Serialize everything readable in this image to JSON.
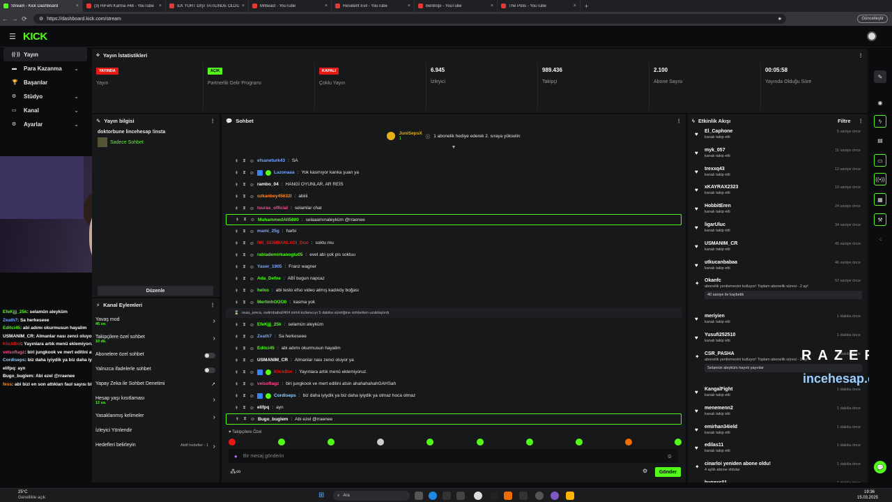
{
  "browser": {
    "tabs": [
      {
        "title": "Stream - Kick Dashboard",
        "active": true,
        "icon": "kick-icon"
      },
      {
        "title": "(3) RiFeN Karma #48 - YouTube",
        "icon": "youtube-icon"
      },
      {
        "title": "İLK YURT DIŞI TATİLİNDE ÖLDÜR...",
        "icon": "youtube-icon"
      },
      {
        "title": "MrBeast - YouTube",
        "icon": "youtube-icon"
      },
      {
        "title": "Resident Evil - YouTube",
        "icon": "youtube-icon"
      },
      {
        "title": "Bentropı - YouTube",
        "icon": "youtube-icon"
      },
      {
        "title": "The Polis - YouTube",
        "icon": "youtube-icon"
      }
    ],
    "url": "https://dashboard.kick.com/stream",
    "update_label": "Güncelleştir"
  },
  "app": {
    "logo": "KICK"
  },
  "nav": [
    {
      "label": "Yayın",
      "icon": "stream-icon",
      "selected": true
    },
    {
      "label": "Para Kazanma",
      "icon": "money-icon",
      "chevron": true
    },
    {
      "label": "Başarılar",
      "icon": "trophy-icon"
    },
    {
      "label": "Stüdyo",
      "icon": "studio-icon",
      "chevron": true
    },
    {
      "label": "Kanal",
      "icon": "channel-icon",
      "chevron": true
    },
    {
      "label": "Ayarlar",
      "icon": "settings-icon",
      "chevron": true
    }
  ],
  "stats": {
    "title": "Yayın İstatistikleri",
    "cells": [
      {
        "badge": "YAYINDA",
        "badge_color": "#e91916",
        "label": "Yayın"
      },
      {
        "badge": "AÇIK",
        "badge_color": "#53fc18",
        "label": "Partnerlik Gelir Programı"
      },
      {
        "badge": "KAPALI",
        "badge_color": "#e91916",
        "label": "Çoklu Yayın"
      },
      {
        "value": "6.945",
        "label": "İzleyici"
      },
      {
        "value": "989.436",
        "label": "Takipçi"
      },
      {
        "value": "2.100",
        "label": "Abone Sayısı"
      },
      {
        "value": "00:05:58",
        "label": "Yayında Olduğu Süre"
      }
    ]
  },
  "info": {
    "title": "Yayın bilgisi",
    "stream_title": "doktorbune lincehesap !insta",
    "mode": "Sadece Sohbet",
    "tag": "Türkçe",
    "edit_label": "Düzenle"
  },
  "overlay_chat": [
    {
      "user": "EfeKjjj_25k",
      "text": "selamün aleyküm",
      "color": "#53fc18"
    },
    {
      "user": "Zeath7",
      "text": "Sa herkeseee",
      "color": "#7aa7ff"
    },
    {
      "user": "Editci45",
      "text": "abi adımı okurmusun hayalim",
      "color": "#53fc18"
    },
    {
      "user": "USMANIM_CR",
      "text": "Almanlar nası zenci oluyor ya",
      "color": "#ffffff"
    },
    {
      "user": "KlickBot",
      "text": "Yayınlara artık menü eklemiyoruz.",
      "color": "#e91916"
    },
    {
      "user": "velsoflagz",
      "text": "biri jungkook ve mert editini atsin ahahahahahGAHSah",
      "color": "#ff4d8d"
    },
    {
      "user": "Cordiseps",
      "text": "biz daha iyiydik ya biz daha iyiydik ya olmaz hoca olmaz",
      "color": "#9ad0ff"
    },
    {
      "user": "elifpq",
      "text": "ayn",
      "color": "#ffffff"
    },
    {
      "user": "Bugo_buglem",
      "text": "Abi ezel @rraenee",
      "color": "#ffffff"
    },
    {
      "user": "fess",
      "text": "abi bizi en son attıkları faul sayısı bitirdi @RRaenee",
      "color": "#ff8c2a"
    }
  ],
  "actions": {
    "title": "Kanal Eylemleri",
    "items": [
      {
        "label": "Yavaş mod",
        "sub": "45 sn.",
        "chevron": true
      },
      {
        "label": "Takipçilere özel sohbet",
        "sub": "10 dk.",
        "chevron": true
      },
      {
        "label": "Abonelere özel sohbet",
        "toggle": true
      },
      {
        "label": "Yalnızca ifadelerle sohbet",
        "toggle": true
      },
      {
        "label": "Yapay Zeka ile Sohbet Denetimi",
        "ext": true
      },
      {
        "label": "Hesap yaşı kısıtlaması",
        "sub": "12 sa.",
        "chevron": true
      },
      {
        "label": "Yasaklanmış kelimeler",
        "chevron": true
      },
      {
        "label": "İzleyici Yönlendir"
      },
      {
        "label": "Hedefleri belirleyin",
        "right": "Aktif hedefler - 1",
        "chevron": true
      }
    ]
  },
  "chat": {
    "title": "Sohbet",
    "gift_user": "JuniSepsX",
    "gift_count": "1",
    "gift_text": "1 abonelik hediye ederek 2. sıraya yükselin",
    "messages": [
      {
        "user": "efsaneturk43",
        "text": "SA",
        "color": "#7aa7ff"
      },
      {
        "user": "Lazonaaa",
        "text": "Yok kasmıyor kanka şuan ya",
        "color": "#7aa7ff",
        "badges": true
      },
      {
        "user": "rambo_04",
        "text": "HANGİ OYUNLAR. AR REİS",
        "color": "#ffffff"
      },
      {
        "user": "ozkanbey45632I",
        "text": "abiiii",
        "color": "#ff8c2a"
      },
      {
        "user": "tsuras_official",
        "text": "selamlar chat",
        "color": "#ff4d8d"
      },
      {
        "user": "MuhammedAli5800",
        "text": "selaaamınaleyküm @rraenee",
        "color": "#53fc18",
        "highlight": true
      },
      {
        "user": "mami_25g",
        "text": "harbi",
        "color": "#7aa7ff"
      },
      {
        "user": "RR_SENIBANLADI_Duo",
        "text": "soktu mu",
        "color": "#e91916"
      },
      {
        "user": "rabiademirkanoglu05",
        "text": "evet abi çok pis soktuu",
        "color": "#53fc18"
      },
      {
        "user": "Yaser_1905",
        "text": "Franz wagner",
        "color": "#7aa7ff"
      },
      {
        "user": "Ada_Defne",
        "text": "ABİ bugun napcaz",
        "color": "#53fc18"
      },
      {
        "user": "helxo",
        "text": "abi testo efso video atmış kadıköy boğası",
        "color": "#53fc18"
      },
      {
        "user": "MertinhOOO0",
        "text": "kasma yok",
        "color": "#53fc18"
      }
    ],
    "system_line": "osas_amca, swlimbaba0404 isimli kullanıcıyı 5 dakika süreliğine sohbetten uzaklaştırdı",
    "messages2": [
      {
        "user": "EfeKjjj_25k",
        "text": "selamün aleyküm",
        "color": "#53fc18"
      },
      {
        "user": "Zeath7",
        "text": "Sa herkeseee",
        "color": "#7aa7ff"
      },
      {
        "user": "Editci45",
        "text": "abi adımı okurmusun hayalim",
        "color": "#53fc18"
      },
      {
        "user": "USMANIM_CR",
        "text": "Almanlar nası zenci oluyor ya",
        "color": "#ffffff"
      },
      {
        "user": "KlickBot",
        "text": "Yayınlara artık menü eklemiyoruz.",
        "color": "#e91916",
        "badges": true
      },
      {
        "user": "velsoflagz",
        "text": "biri jungkook ve mert editini atsin ahahahahahGAHSah",
        "color": "#ff4d8d"
      },
      {
        "user": "Cordiseps",
        "text": "biz daha iyiydik ya biz daha iyiydik ya olmaz hoca olmaz",
        "color": "#9ad0ff",
        "badges": true
      },
      {
        "user": "elifpq",
        "text": "ayn",
        "color": "#ffffff"
      },
      {
        "user": "Bugo_buglem",
        "text": "Abi ezel @rraenee",
        "color": "#ffffff",
        "highlight": true
      }
    ],
    "followers_only": "Takipçilere Özel",
    "input_placeholder": "Bir mesaj gönderin",
    "send_label": "Gönder"
  },
  "activity": {
    "title": "Etkinlik Akışı",
    "filter_label": "Filtre",
    "items": [
      {
        "user": "El_Caphone",
        "desc": "kanalı takip etti",
        "time": "5 saniye önce"
      },
      {
        "user": "myk_057",
        "desc": "kanalı takip etti",
        "time": "11 saniye önce"
      },
      {
        "user": "trexxq43",
        "desc": "kanalı takip etti",
        "time": "12 saniye önce"
      },
      {
        "user": "xKAYRAX2323",
        "desc": "kanalı takip etti",
        "time": "19 saniye önce"
      },
      {
        "user": "HobbitEren",
        "desc": "kanalı takip etti",
        "time": "24 saniye önce"
      },
      {
        "user": "ligarUluc",
        "desc": "kanalı takip etti",
        "time": "34 saniye önce"
      },
      {
        "user": "USMANIM_CR",
        "desc": "kanalı takip etti",
        "time": "45 saniye önce"
      },
      {
        "user": "utkucanbabaa",
        "desc": "kanalı takip etti",
        "time": "46 saniye önce"
      },
      {
        "user": "Okanfc",
        "desc": "abonelik yenilemesini kutluyor! Toplam abonelik süresi - 2 ay!",
        "time": "57 saniye önce",
        "pill": "40 saniye ile kaybetik",
        "sub": true
      },
      {
        "user": "meriyien",
        "desc": "kanalı takip etti",
        "time": "1 dakika önce"
      },
      {
        "user": "Yusufi252510",
        "desc": "kanalı takip etti",
        "time": "1 dakika önce"
      },
      {
        "user": "CSR_PASHA",
        "desc": "abonelik yenilemesini kutluyor! Toplam abonelik süresi - 2 ay!",
        "time": "1 dakika önce",
        "pill": "Selamün aleyküm hayırlı yayınlar",
        "sub": true
      },
      {
        "user": "KangalFight",
        "desc": "kanalı takip etti",
        "time": "1 dakika önce"
      },
      {
        "user": "menemenn2",
        "desc": "kanalı takip etti",
        "time": "1 dakika önce"
      },
      {
        "user": "emirhan34ield",
        "desc": "kanalı takip etti",
        "time": "1 dakika önce"
      },
      {
        "user": "edilas11",
        "desc": "kanalı takip etti",
        "time": "1 dakika önce"
      },
      {
        "user": "cinarloi yeniden abone oldu!",
        "desc": "4 aylık abone oldular",
        "time": "1 dakika önce",
        "sub": true
      },
      {
        "user": "bugaxs01",
        "desc": "",
        "time": "1 dakika önce"
      }
    ]
  },
  "overlay_brand": {
    "razer": "RAZER",
    "site": "incehesap.com"
  },
  "taskbar": {
    "temp": "25°C",
    "weather": "Genellikle açık",
    "search": "Ara",
    "time": "19:36",
    "date": "15.03.2025"
  },
  "colors": {
    "accent": "#53fc18",
    "live": "#e91916",
    "bg": "#0b0c0d",
    "panel": "#17181a"
  }
}
